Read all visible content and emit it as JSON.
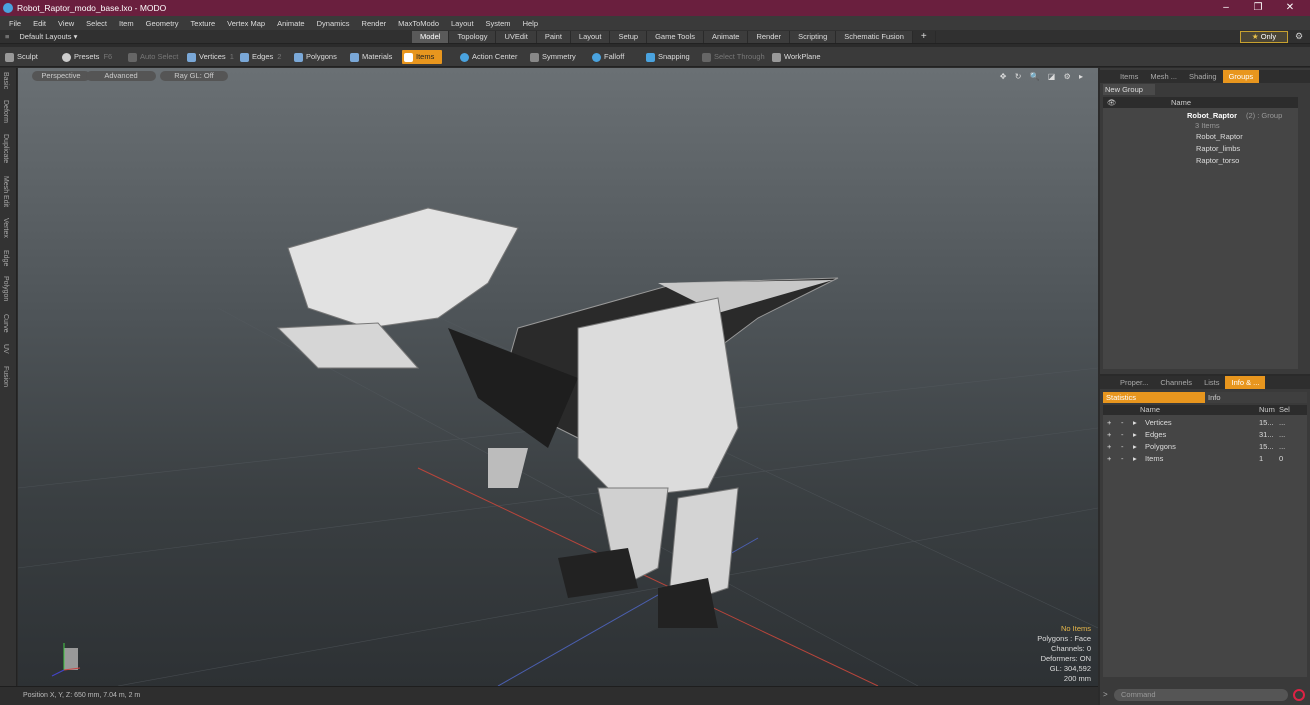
{
  "title": "Robot_Raptor_modo_base.lxo - MODO",
  "window_buttons": [
    "–",
    "❐",
    "✕"
  ],
  "menu": [
    "File",
    "Edit",
    "View",
    "Select",
    "Item",
    "Geometry",
    "Texture",
    "Vertex Map",
    "Animate",
    "Dynamics",
    "Render",
    "MaxToModo",
    "Layout",
    "System",
    "Help"
  ],
  "layout_selector": "Default Layouts ▾",
  "layout_tabs": [
    "Model",
    "Topology",
    "UVEdit",
    "Paint",
    "Layout",
    "Setup",
    "Game Tools",
    "Animate",
    "Render",
    "Scripting",
    "Schematic Fusion"
  ],
  "active_tab": "Model",
  "only_label": "Only",
  "toolbar": {
    "sculpt": "Sculpt",
    "presets": "Presets",
    "presets_key": "F6",
    "auto_select": "Auto Select",
    "vertices": "Vertices",
    "vertices_num": "1",
    "edges": "Edges",
    "edges_num": "2",
    "polygons": "Polygons",
    "materials": "Materials",
    "items": "Items",
    "action_center": "Action Center",
    "symmetry": "Symmetry",
    "falloff": "Falloff",
    "snapping": "Snapping",
    "select_through": "Select Through",
    "workplane": "WorkPlane"
  },
  "left_tabs": [
    "Basic",
    "Deform",
    "Duplicate",
    "Mesh Edit",
    "Vertex",
    "Edge",
    "Polygon",
    "Curve",
    "UV",
    "Fusion"
  ],
  "viewport": {
    "perspective": "Perspective",
    "advanced": "Advanced",
    "raygl": "Ray GL: Off",
    "icons": "✥ ↻ 🔍 ◪ ⚙ ▸",
    "stats": {
      "no_items": "No Items",
      "polygons": "Polygons : Face",
      "channels": "Channels: 0",
      "deformers": "Deformers: ON",
      "gl": "GL: 304,592",
      "scale": "200 mm"
    }
  },
  "status": {
    "position": "Position X, Y, Z:   650 mm, 7.04 m, 2 m"
  },
  "groups_panel": {
    "tabs": [
      "Items",
      "Mesh ...",
      "Shading",
      "Groups"
    ],
    "active_tab": "Groups",
    "new_group": "New Group",
    "col_name": "Name",
    "group_name": "Robot_Raptor",
    "group_suffix": "(2) : Group",
    "group_count": "3 Items",
    "children": [
      "Robot_Raptor",
      "Raptor_limbs",
      "Raptor_torso"
    ]
  },
  "info_panel": {
    "tabs": [
      "Proper...",
      "Channels",
      "Lists",
      "Info & ..."
    ],
    "active_tab": "Info & ...",
    "sub_tabs": [
      "Statistics",
      "Info"
    ],
    "headers": [
      "Name",
      "Num",
      "Sel"
    ],
    "rows": [
      {
        "name": "Vertices",
        "num": "15...",
        "sel": "..."
      },
      {
        "name": "Edges",
        "num": "31...",
        "sel": "..."
      },
      {
        "name": "Polygons",
        "num": "15...",
        "sel": "..."
      },
      {
        "name": "Items",
        "num": "1",
        "sel": "0"
      }
    ]
  },
  "command_placeholder": "Command",
  "colors": {
    "accent": "#e8961e",
    "titlebar": "#6a1f3e"
  }
}
